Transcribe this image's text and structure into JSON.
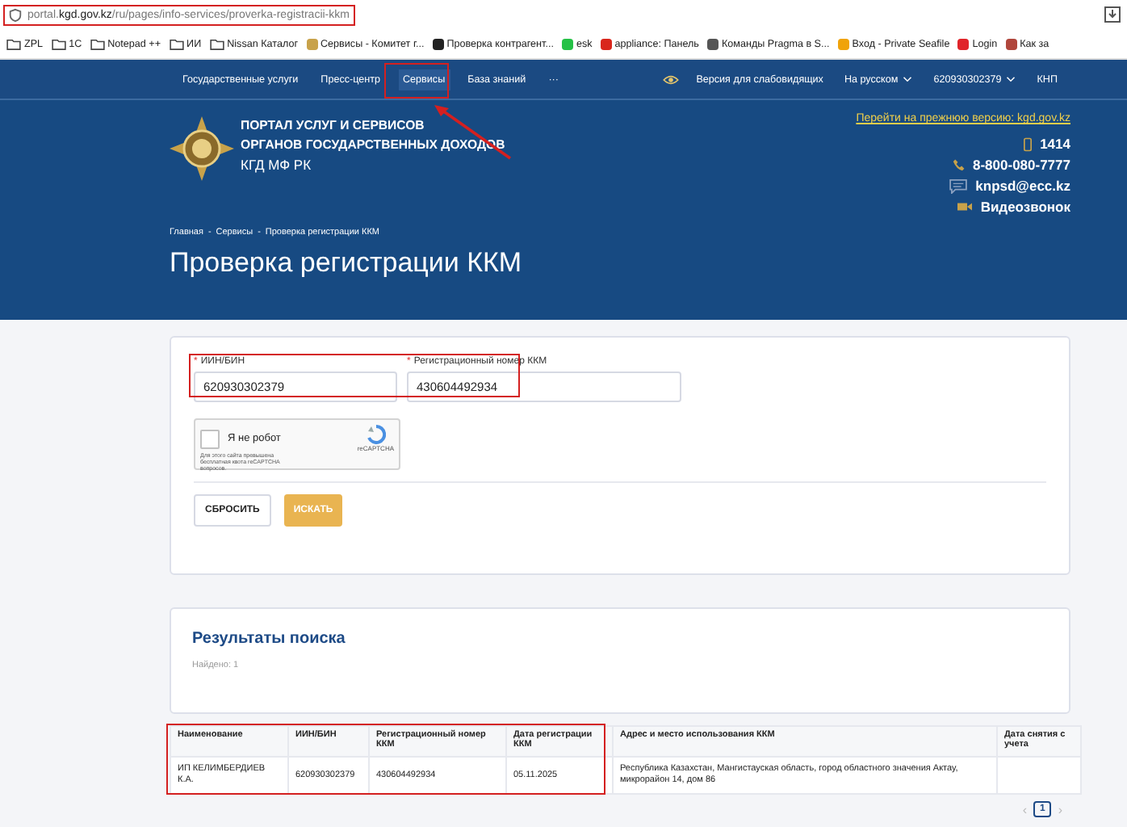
{
  "browser": {
    "url": "portal.**kgd.gov.kz**/ru/pages/info-services/proverka-registracii-kkm",
    "bookmarks": [
      {
        "kind": "folder",
        "label": "ZPL"
      },
      {
        "kind": "folder",
        "label": "1С"
      },
      {
        "kind": "folder",
        "label": "Notepad ++"
      },
      {
        "kind": "folder",
        "label": "ИИ"
      },
      {
        "kind": "folder",
        "label": "Nissan Каталог"
      },
      {
        "kind": "site",
        "label": "Сервисы - Комитет г...",
        "color": "#c8a24a"
      },
      {
        "kind": "site",
        "label": "Проверка контрагент...",
        "color": "#222222"
      },
      {
        "kind": "site",
        "label": "esk",
        "color": "#25c146"
      },
      {
        "kind": "site",
        "label": "appliance: Панель",
        "color": "#d9261c"
      },
      {
        "kind": "site",
        "label": "Команды Pragma в S...",
        "color": "#555555"
      },
      {
        "kind": "site",
        "label": "Вход - Private Seafile",
        "color": "#f0a30a"
      },
      {
        "kind": "site",
        "label": "Login",
        "color": "#e0242a"
      },
      {
        "kind": "site",
        "label": "Как за",
        "color": "#b0463c"
      }
    ]
  },
  "nav": {
    "items": [
      {
        "label": "Государственные услуги",
        "selected": false
      },
      {
        "label": "Пресс-центр",
        "selected": false
      },
      {
        "label": "Сервисы",
        "selected": true
      },
      {
        "label": "База знаний",
        "selected": false
      }
    ],
    "more": "···",
    "accessibility": "Версия для слабовидящих",
    "language": "На русском",
    "user": "620930302379",
    "role": "КНП"
  },
  "header": {
    "title_lines": [
      "ПОРТАЛ УСЛУГ И СЕРВИСОВ",
      "ОРГАНОВ ГОСУДАРСТВЕННЫХ ДОХОДОВ"
    ],
    "subtitle": "КГД МФ РК",
    "old_version_link": "Перейти на прежнюю версию: kgd.gov.kz",
    "contacts": [
      {
        "kind": "mobile",
        "text": "1414"
      },
      {
        "kind": "phone",
        "text": "8-800-080-7777"
      },
      {
        "kind": "chat",
        "text": "knpsd@ecc.kz"
      },
      {
        "kind": "video",
        "text": "Видеозвонок"
      }
    ],
    "breadcrumbs": [
      "Главная",
      "Сервисы",
      "Проверка регистрации ККМ"
    ],
    "separator": "-",
    "page_title": "Проверка регистрации ККМ"
  },
  "form": {
    "fields": [
      {
        "mark": "*",
        "label": "ИИН/БИН",
        "value": "620930302379"
      },
      {
        "mark": "*",
        "label": "Регистрационный номер ККМ",
        "value": "430604492934"
      }
    ],
    "captcha": {
      "checked": false,
      "label": "Я не робот",
      "brand": "reCAPTCHA",
      "notice": "Для этого сайта превышена бесплатная квота reCAPTCHA вопросов."
    },
    "buttons": [
      {
        "kind": "secondary",
        "label": "СБРОСИТЬ"
      },
      {
        "kind": "primary",
        "label": "ИСКАТЬ"
      }
    ]
  },
  "results": {
    "title": "Результаты поиска",
    "found": "Найдено: 1",
    "table": {
      "columns": [
        "Наименование",
        "ИИН/БИН",
        "Регистрационный номер ККМ",
        "Дата регистрации ККМ",
        "Адрес и место использования ККМ",
        "Дата снятия с учета"
      ],
      "rows": [
        [
          "ИП КЕЛИМБЕРДИЕВ К.А.",
          "620930302379",
          "430604492934",
          "05.11.2025",
          "Республика Казахстан, Мангистауская область, город областного значения Актау, микрорайон 14, дом 86",
          ""
        ]
      ]
    },
    "pagination": {
      "prev": "‹",
      "next": "›",
      "pages": [
        {
          "label": "1",
          "selected": true
        }
      ]
    }
  }
}
